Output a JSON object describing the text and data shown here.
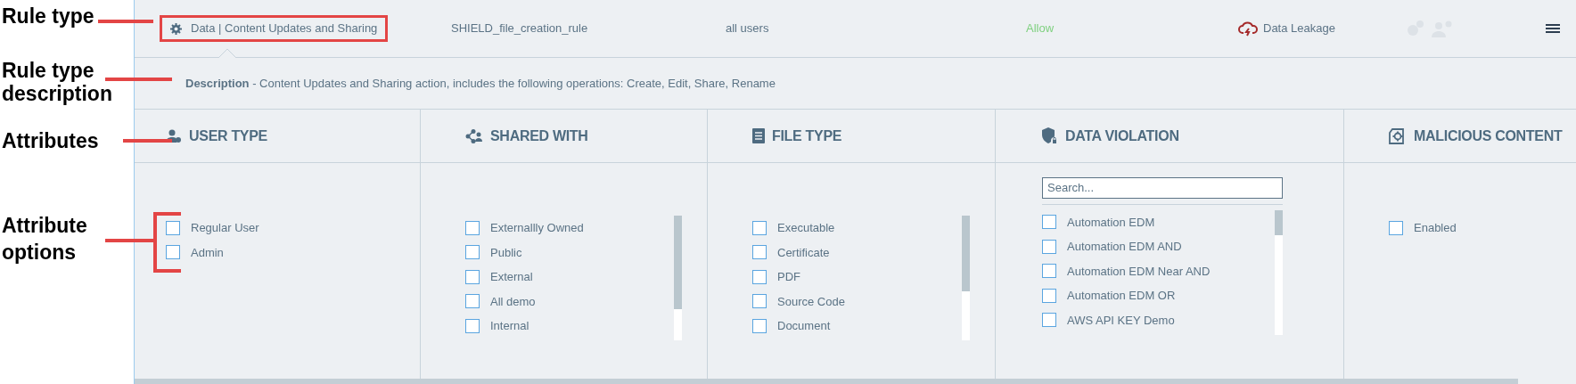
{
  "annotations": [
    {
      "text": "Rule type"
    },
    {
      "text": "Rule type description"
    },
    {
      "text": "Attributes"
    },
    {
      "text": "Attribute options"
    }
  ],
  "rule": {
    "type": "Data | Content Updates and Sharing",
    "name": "SHIELD_file_creation_rule",
    "users": "all users",
    "action": "Allow",
    "category": "Data Leakage"
  },
  "description": {
    "label": "Description",
    "text": " - Content Updates and Sharing action, includes the following operations: Create, Edit, Share, Rename"
  },
  "attributes": [
    {
      "kind": "user",
      "title": "USER TYPE",
      "options": [
        {
          "label": "Regular User",
          "checked": false
        },
        {
          "label": "Admin",
          "checked": false
        }
      ]
    },
    {
      "kind": "share",
      "title": "SHARED WITH",
      "options": [
        {
          "label": "Externallly Owned",
          "checked": false
        },
        {
          "label": "Public",
          "checked": false
        },
        {
          "label": "External",
          "checked": false
        },
        {
          "label": "All demo",
          "checked": false
        },
        {
          "label": "Internal",
          "checked": false
        }
      ]
    },
    {
      "kind": "file",
      "title": "FILE TYPE",
      "options": [
        {
          "label": "Executable",
          "checked": false
        },
        {
          "label": "Certificate",
          "checked": false
        },
        {
          "label": "PDF",
          "checked": false
        },
        {
          "label": "Source Code",
          "checked": false
        },
        {
          "label": "Document",
          "checked": false
        }
      ]
    },
    {
      "kind": "violation",
      "title": "DATA VIOLATION",
      "search": {
        "placeholder": "Search..."
      },
      "options": [
        {
          "label": "Automation EDM",
          "checked": false
        },
        {
          "label": "Automation EDM AND",
          "checked": false
        },
        {
          "label": "Automation EDM Near AND",
          "checked": false
        },
        {
          "label": "Automation EDM OR",
          "checked": false
        },
        {
          "label": "AWS API KEY Demo",
          "checked": false
        }
      ]
    },
    {
      "kind": "malware",
      "title": "MALICIOUS CONTENT",
      "options": [
        {
          "label": "Enabled",
          "checked": false
        }
      ]
    }
  ]
}
